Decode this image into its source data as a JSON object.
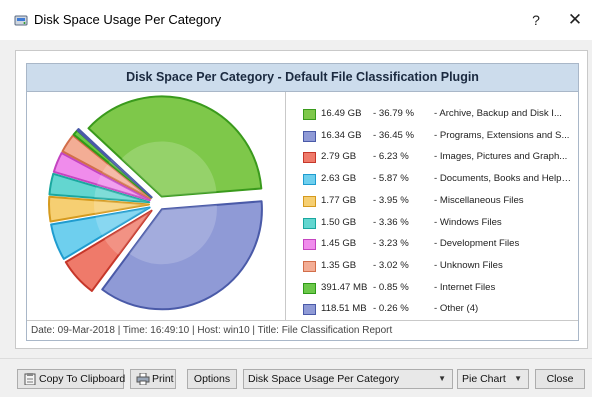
{
  "window": {
    "title": "Disk Space Usage Per Category",
    "help_label": "?",
    "close_label": "✕"
  },
  "chart": {
    "header": "Disk Space Per Category - Default File Classification Plugin",
    "status": "Date: 09-Mar-2018 | Time: 16:49:10 | Host: win10 | Title: File Classification Report"
  },
  "chart_data": {
    "type": "pie",
    "title": "Disk Space Per Category - Default File Classification Plugin",
    "slices": [
      {
        "label": "Archive, Backup and Disk Images",
        "size": "16.49 GB",
        "percent": 36.79,
        "color": "#7ec84a",
        "edge": "#3a9a1c"
      },
      {
        "label": "Programs, Extensions and System Files",
        "size": "16.34 GB",
        "percent": 36.45,
        "color": "#8f9ad6",
        "edge": "#4a5aa8"
      },
      {
        "label": "Images, Pictures and Graphics",
        "size": "2.79 GB",
        "percent": 6.23,
        "color": "#ef7a6a",
        "edge": "#c6372a"
      },
      {
        "label": "Documents, Books and Help Files",
        "size": "2.63 GB",
        "percent": 5.87,
        "color": "#6ecfee",
        "edge": "#1f9ccf"
      },
      {
        "label": "Miscellaneous Files",
        "size": "1.77 GB",
        "percent": 3.95,
        "color": "#f6cf72",
        "edge": "#d59a1e"
      },
      {
        "label": "Windows Files",
        "size": "1.50 GB",
        "percent": 3.36,
        "color": "#63d6d0",
        "edge": "#1aa79f"
      },
      {
        "label": "Development Files",
        "size": "1.45 GB",
        "percent": 3.23,
        "color": "#f08cec",
        "edge": "#c444c0"
      },
      {
        "label": "Unknown Files",
        "size": "1.35 GB",
        "percent": 3.02,
        "color": "#f3ad95",
        "edge": "#d26e4a"
      },
      {
        "label": "Internet Files",
        "size": "391.47 MB",
        "percent": 0.85,
        "color": "#6cc84a",
        "edge": "#2f9a18"
      },
      {
        "label": "Other (4)",
        "size": "118.51 MB",
        "percent": 0.26,
        "color": "#8f9ad6",
        "edge": "#4a5aa8"
      }
    ]
  },
  "legend": [
    {
      "size": "16.49 GB",
      "pct": "- 36.79 %",
      "name": "- Archive, Backup and Disk I..."
    },
    {
      "size": "16.34 GB",
      "pct": "- 36.45 %",
      "name": "- Programs, Extensions and S..."
    },
    {
      "size": "2.79 GB",
      "pct": "- 6.23 %",
      "name": "- Images, Pictures and Graph..."
    },
    {
      "size": "2.63 GB",
      "pct": "- 5.87 %",
      "name": "- Documents, Books and Help ..."
    },
    {
      "size": "1.77 GB",
      "pct": "- 3.95 %",
      "name": "- Miscellaneous Files"
    },
    {
      "size": "1.50 GB",
      "pct": "- 3.36 %",
      "name": "- Windows Files"
    },
    {
      "size": "1.45 GB",
      "pct": "- 3.23 %",
      "name": "- Development Files"
    },
    {
      "size": "1.35 GB",
      "pct": "- 3.02 %",
      "name": "- Unknown Files"
    },
    {
      "size": "391.47 MB",
      "pct": "- 0.85 %",
      "name": "- Internet Files"
    },
    {
      "size": "118.51 MB",
      "pct": "- 0.26 %",
      "name": "- Other (4)"
    }
  ],
  "toolbar": {
    "copy_label": "Copy To Clipboard",
    "print_label": "Print",
    "options_label": "Options",
    "report_select": "Disk Space Usage Per Category",
    "chart_type_select": "Pie Chart",
    "close_label": "Close",
    "dropdown_arrow": "▼"
  }
}
